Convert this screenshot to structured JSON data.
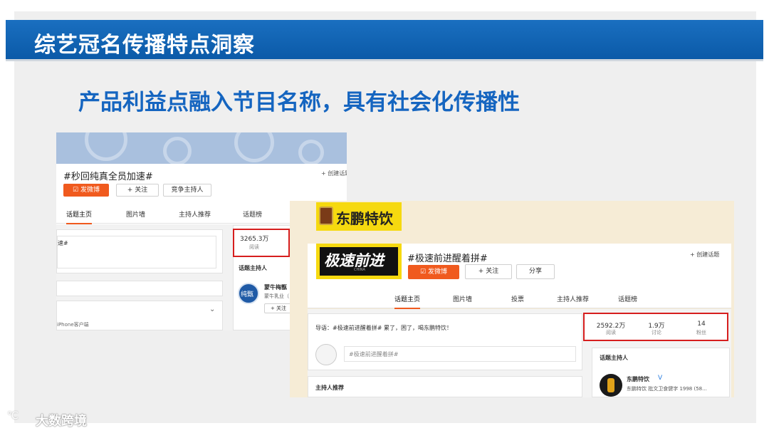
{
  "slide": {
    "title": "综艺冠名传播特点洞察",
    "headline": "产品利益点融入节目名称，具有社会化传播性",
    "watermark": "大数跨境"
  },
  "shot1": {
    "topic_title": "#秒回纯真全员加速#",
    "create_topic": "+ 创建话题",
    "post_button": "发微博",
    "follow_button": "+ 关注",
    "host_button": "竞争主持人",
    "tabs": [
      "话题主页",
      "图片墙",
      "主持人推荐",
      "话题榜"
    ],
    "input_text": "速#",
    "device_text": "iPhone客户端",
    "stats": {
      "reads": "3265.3万",
      "reads_label": "阅读"
    },
    "host_section": "话题主持人",
    "host_name": "蒙牛梅甑",
    "host_desc": "蒙牛乳业（",
    "host_avatar_text": "纯甄",
    "host_follow": "+ 关注"
  },
  "shot2": {
    "logo_top": "东鹏特饮",
    "logo_bottom": "极速前进",
    "logo_china": "CHINA",
    "topic_title": "#极速前进醒着拼#",
    "create_topic": "+ 创建话题",
    "post_button": "发微博",
    "follow_button": "+ 关注",
    "share_button": "分享",
    "tabs": [
      "话题主页",
      "图片墙",
      "投票",
      "主持人推荐",
      "话题榜"
    ],
    "intro": "导语：#极速前进醒着拼# 累了，困了，喝东鹏特饮！",
    "input_placeholder": "#极速前进醒着拼#",
    "stats": {
      "reads": "2592.2万",
      "reads_label": "阅读",
      "discuss": "1.9万",
      "discuss_label": "讨论",
      "fans": "14",
      "fans_label": "粉丝"
    },
    "host_section": "话题主持人",
    "host_name": "东鹏特饮",
    "host_desc": "东鹏特饮 批文卫食健字 1998 (58...",
    "host_recommend": "主持人推荐"
  }
}
